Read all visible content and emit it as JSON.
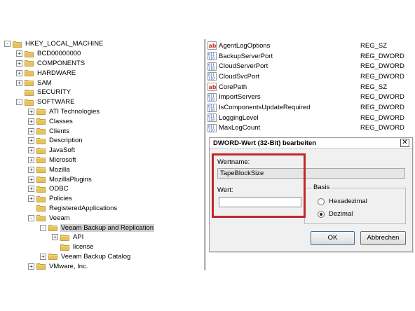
{
  "tree": {
    "items": [
      {
        "label": "HKEY_LOCAL_MACHINE",
        "level": 0,
        "expander": "-",
        "selected": false
      },
      {
        "label": "BCD00000000",
        "level": 1,
        "expander": "+",
        "selected": false
      },
      {
        "label": "COMPONENTS",
        "level": 1,
        "expander": "+",
        "selected": false
      },
      {
        "label": "HARDWARE",
        "level": 1,
        "expander": "+",
        "selected": false
      },
      {
        "label": "SAM",
        "level": 1,
        "expander": "+",
        "selected": false
      },
      {
        "label": "SECURITY",
        "level": 1,
        "expander": "",
        "selected": false
      },
      {
        "label": "SOFTWARE",
        "level": 1,
        "expander": "-",
        "selected": false
      },
      {
        "label": "ATI Technologies",
        "level": 2,
        "expander": "+",
        "selected": false
      },
      {
        "label": "Classes",
        "level": 2,
        "expander": "+",
        "selected": false
      },
      {
        "label": "Clients",
        "level": 2,
        "expander": "+",
        "selected": false
      },
      {
        "label": "Description",
        "level": 2,
        "expander": "+",
        "selected": false
      },
      {
        "label": "JavaSoft",
        "level": 2,
        "expander": "+",
        "selected": false
      },
      {
        "label": "Microsoft",
        "level": 2,
        "expander": "+",
        "selected": false
      },
      {
        "label": "Mozilla",
        "level": 2,
        "expander": "+",
        "selected": false
      },
      {
        "label": "MozillaPlugins",
        "level": 2,
        "expander": "+",
        "selected": false
      },
      {
        "label": "ODBC",
        "level": 2,
        "expander": "+",
        "selected": false
      },
      {
        "label": "Policies",
        "level": 2,
        "expander": "+",
        "selected": false
      },
      {
        "label": "RegisteredApplications",
        "level": 2,
        "expander": "",
        "selected": false
      },
      {
        "label": "Veeam",
        "level": 2,
        "expander": "-",
        "selected": false
      },
      {
        "label": "Veeam Backup and Replication",
        "level": 3,
        "expander": "-",
        "selected": true
      },
      {
        "label": "API",
        "level": 4,
        "expander": "+",
        "selected": false
      },
      {
        "label": "license",
        "level": 4,
        "expander": "",
        "selected": false
      },
      {
        "label": "Veeam Backup Catalog",
        "level": 3,
        "expander": "+",
        "selected": false
      },
      {
        "label": "VMware, Inc.",
        "level": 2,
        "expander": "+",
        "selected": false
      }
    ]
  },
  "values": {
    "rows": [
      {
        "icon": "string-value-icon",
        "name": "AgentLogOptions",
        "type": "REG_SZ"
      },
      {
        "icon": "dword-value-icon",
        "name": "BackupServerPort",
        "type": "REG_DWORD"
      },
      {
        "icon": "dword-value-icon",
        "name": "CloudServerPort",
        "type": "REG_DWORD"
      },
      {
        "icon": "dword-value-icon",
        "name": "CloudSvcPort",
        "type": "REG_DWORD"
      },
      {
        "icon": "string-value-icon",
        "name": "CorePath",
        "type": "REG_SZ"
      },
      {
        "icon": "dword-value-icon",
        "name": "ImportServers",
        "type": "REG_DWORD"
      },
      {
        "icon": "dword-value-icon",
        "name": "IsComponentsUpdateRequired",
        "type": "REG_DWORD"
      },
      {
        "icon": "dword-value-icon",
        "name": "LoggingLevel",
        "type": "REG_DWORD"
      },
      {
        "icon": "dword-value-icon",
        "name": "MaxLogCount",
        "type": "REG_DWORD"
      }
    ]
  },
  "dialog": {
    "title": "DWORD-Wert (32-Bit) bearbeiten",
    "close_glyph": "✕",
    "name_label": "Wertname:",
    "name_value": "TapeBlockSize",
    "data_label": "Wert:",
    "data_value": "",
    "base_label": "Basis",
    "hex_label": "Hexadezimal",
    "dec_label": "Dezimal",
    "hex_selected": false,
    "dec_selected": true,
    "ok_label": "OK",
    "cancel_label": "Abbrechen"
  },
  "colors": {
    "highlight": "#c0282a",
    "folder": "#e8c25a",
    "selection": "#cfcfcf"
  }
}
